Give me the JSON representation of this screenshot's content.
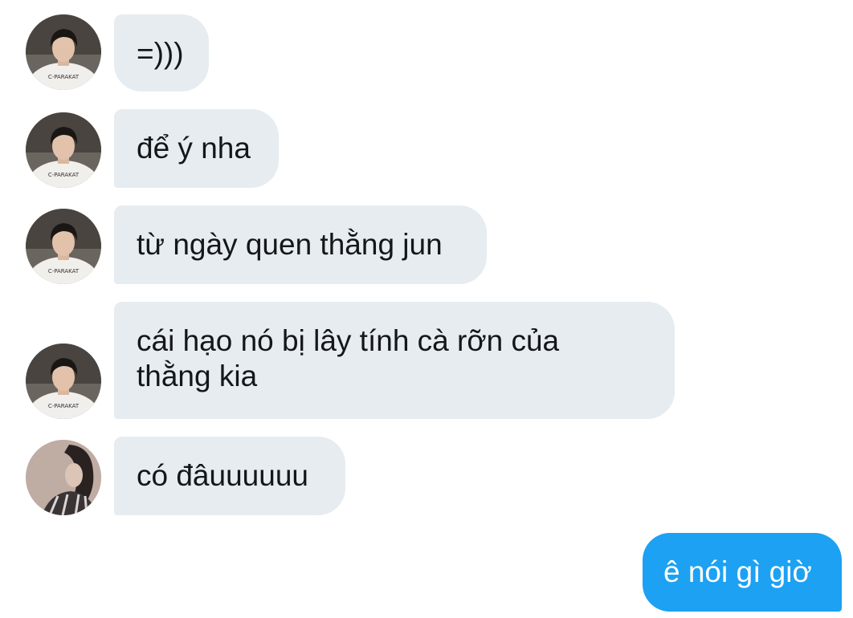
{
  "messages": [
    {
      "direction": "incoming",
      "sender": "user-a",
      "text": "=)))"
    },
    {
      "direction": "incoming",
      "sender": "user-a",
      "text": "để ý nha"
    },
    {
      "direction": "incoming",
      "sender": "user-a",
      "text": "từ ngày quen thằng jun"
    },
    {
      "direction": "incoming",
      "sender": "user-a",
      "text": "cái hạo nó bị lây tính cà rỡn của thằng kia"
    },
    {
      "direction": "incoming",
      "sender": "user-b",
      "text": "có đâuuuuuu"
    },
    {
      "direction": "outgoing",
      "sender": "me",
      "text": "ê nói gì giờ"
    }
  ],
  "colors": {
    "incoming_bubble": "#e6ecf0",
    "incoming_text": "#14171a",
    "outgoing_bubble": "#1da1f2",
    "outgoing_text": "#ffffff"
  },
  "icons": {
    "user_a_avatar_shirt_text": "C-PARAKAT"
  }
}
